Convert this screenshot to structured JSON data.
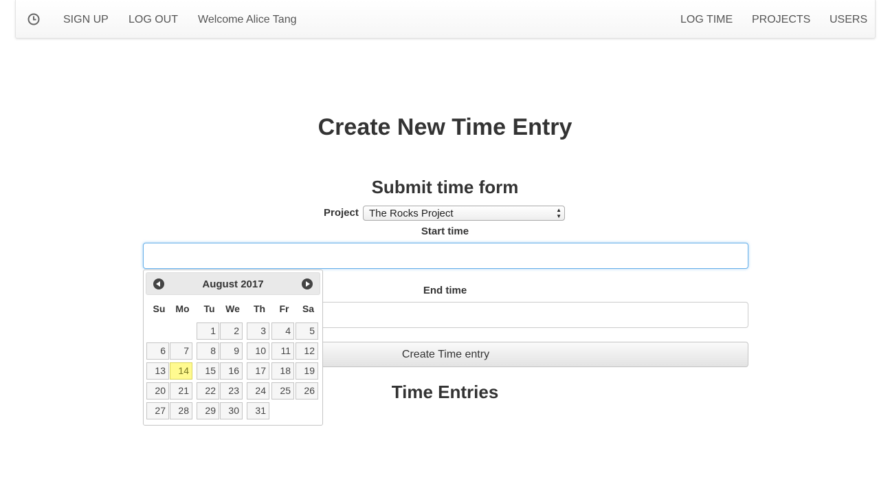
{
  "nav": {
    "icon": "clock-icon",
    "left": [
      "SIGN UP",
      "LOG OUT"
    ],
    "welcome": "Welcome Alice Tang",
    "right": [
      "LOG TIME",
      "PROJECTS",
      "USERS"
    ]
  },
  "page": {
    "title": "Create New Time Entry"
  },
  "form": {
    "title": "Submit time form",
    "project_label": "Project",
    "project_value": "The Rocks Project",
    "start_label": "Start time",
    "start_value": "",
    "end_label": "End time",
    "end_value": "",
    "submit_label": "Create Time entry"
  },
  "entries": {
    "title": "Time Entries"
  },
  "datepicker": {
    "title": "August 2017",
    "prev_icon": "chevron-left-icon",
    "next_icon": "chevron-right-icon",
    "weekdays": [
      "Su",
      "Mo",
      "Tu",
      "We",
      "Th",
      "Fr",
      "Sa"
    ],
    "first_weekday": 2,
    "days_in_month": 31,
    "highlighted_day": 14,
    "highlight_color": "#fffa90"
  }
}
